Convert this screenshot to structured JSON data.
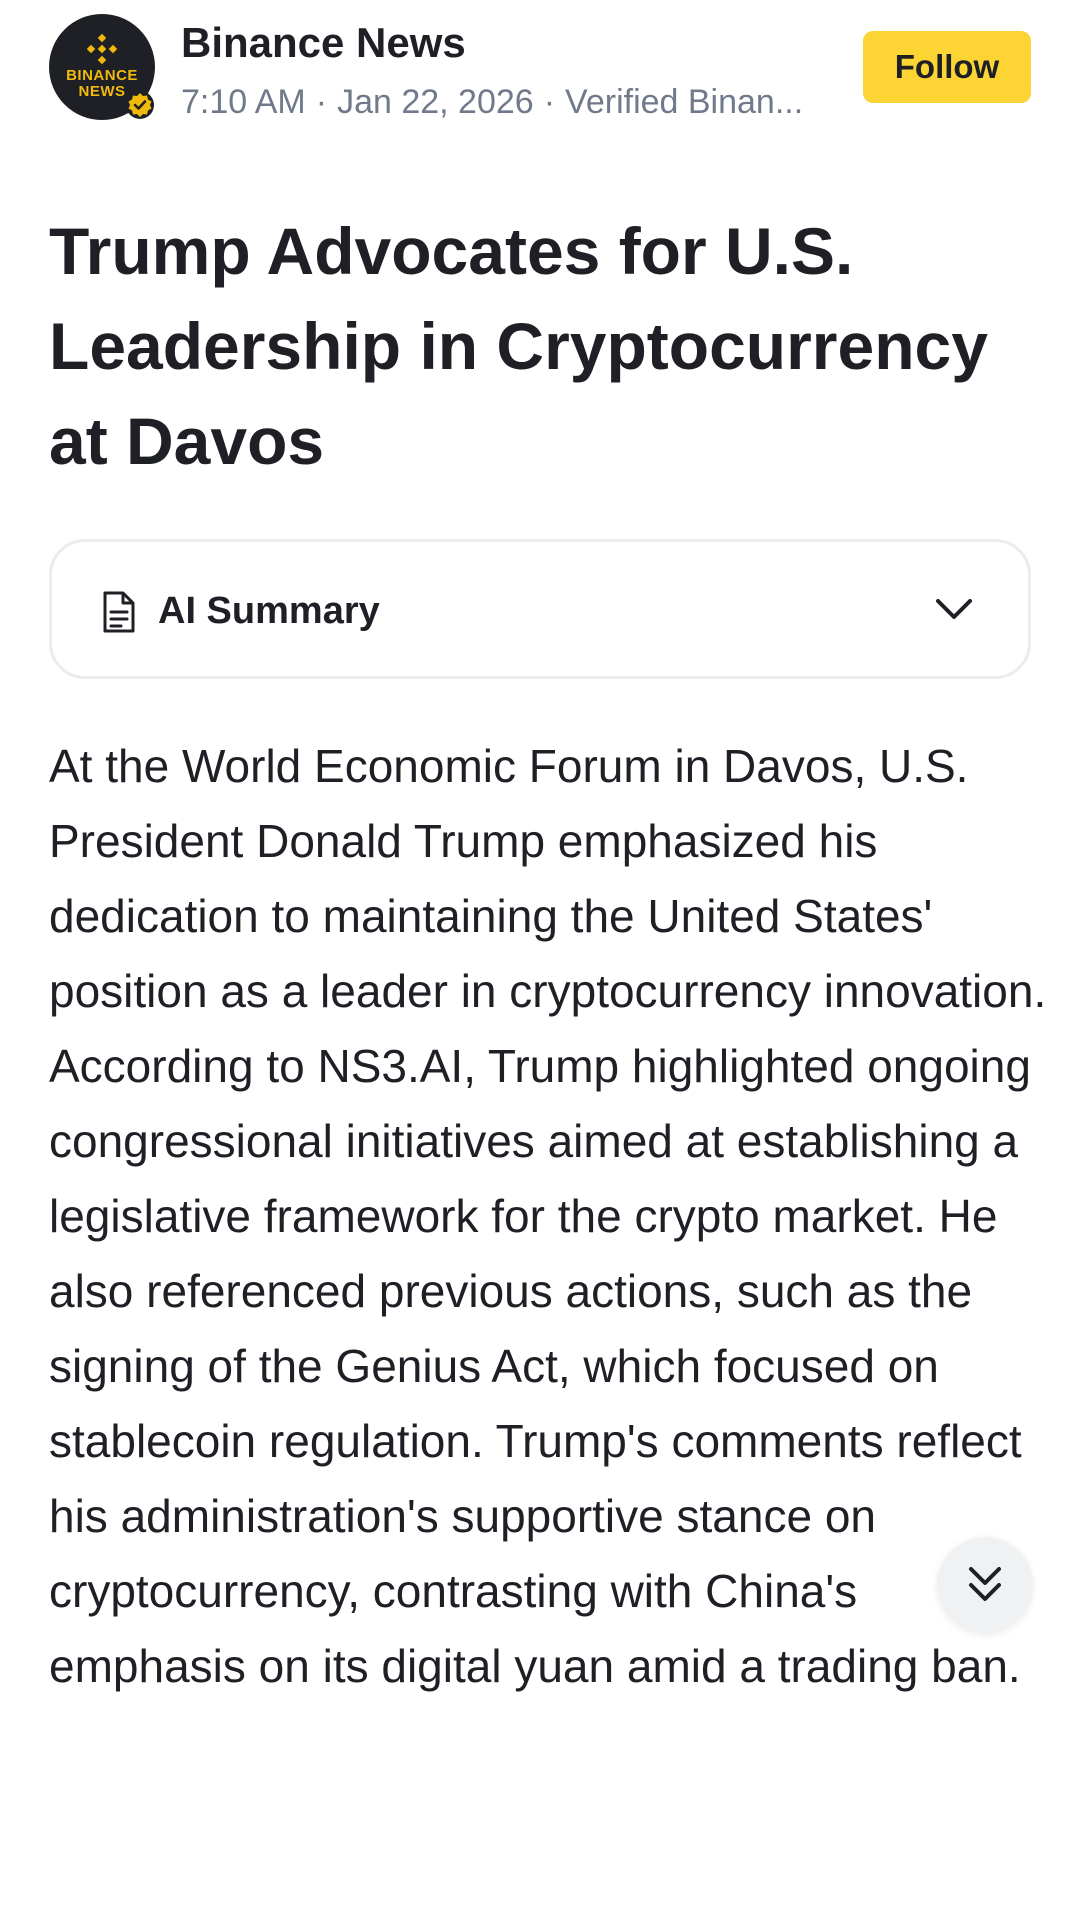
{
  "colors": {
    "accent": "#fcd535",
    "logo_yellow": "#f0b90b",
    "text_primary": "#1e2026",
    "text_secondary": "#707a8a",
    "border": "#eaecef"
  },
  "header": {
    "avatar_text": "BINANCE NEWS",
    "author": "Binance News",
    "time": "7:10 AM",
    "date": "Jan 22, 2026",
    "source": "Verified Binan...",
    "follow_label": "Follow"
  },
  "article": {
    "title": "Trump Advocates for U.S. Leadership in Cryptocurrency at Davos",
    "ai_summary_label": "AI Summary",
    "body": "At the World Economic Forum in Davos, U.S. President Donald Trump emphasized his dedication to maintaining the United States' position as a leader in cryptocurrency innovation. According to NS3.AI, Trump highlighted ongoing congressional initiatives aimed at establishing a legislative framework for the crypto market. He also referenced previous actions, such as the signing of the Genius Act, which focused on stablecoin regulation. Trump's comments reflect his administration's supportive stance on cryptocurrency, contrasting with China's emphasis on its digital yuan amid a trading ban."
  },
  "icons": {
    "avatar_logo": "binance-logo-icon",
    "verified": "verified-badge-icon",
    "summary": "document-icon",
    "expand": "chevron-down-icon",
    "scroll": "double-chevron-down-icon"
  }
}
